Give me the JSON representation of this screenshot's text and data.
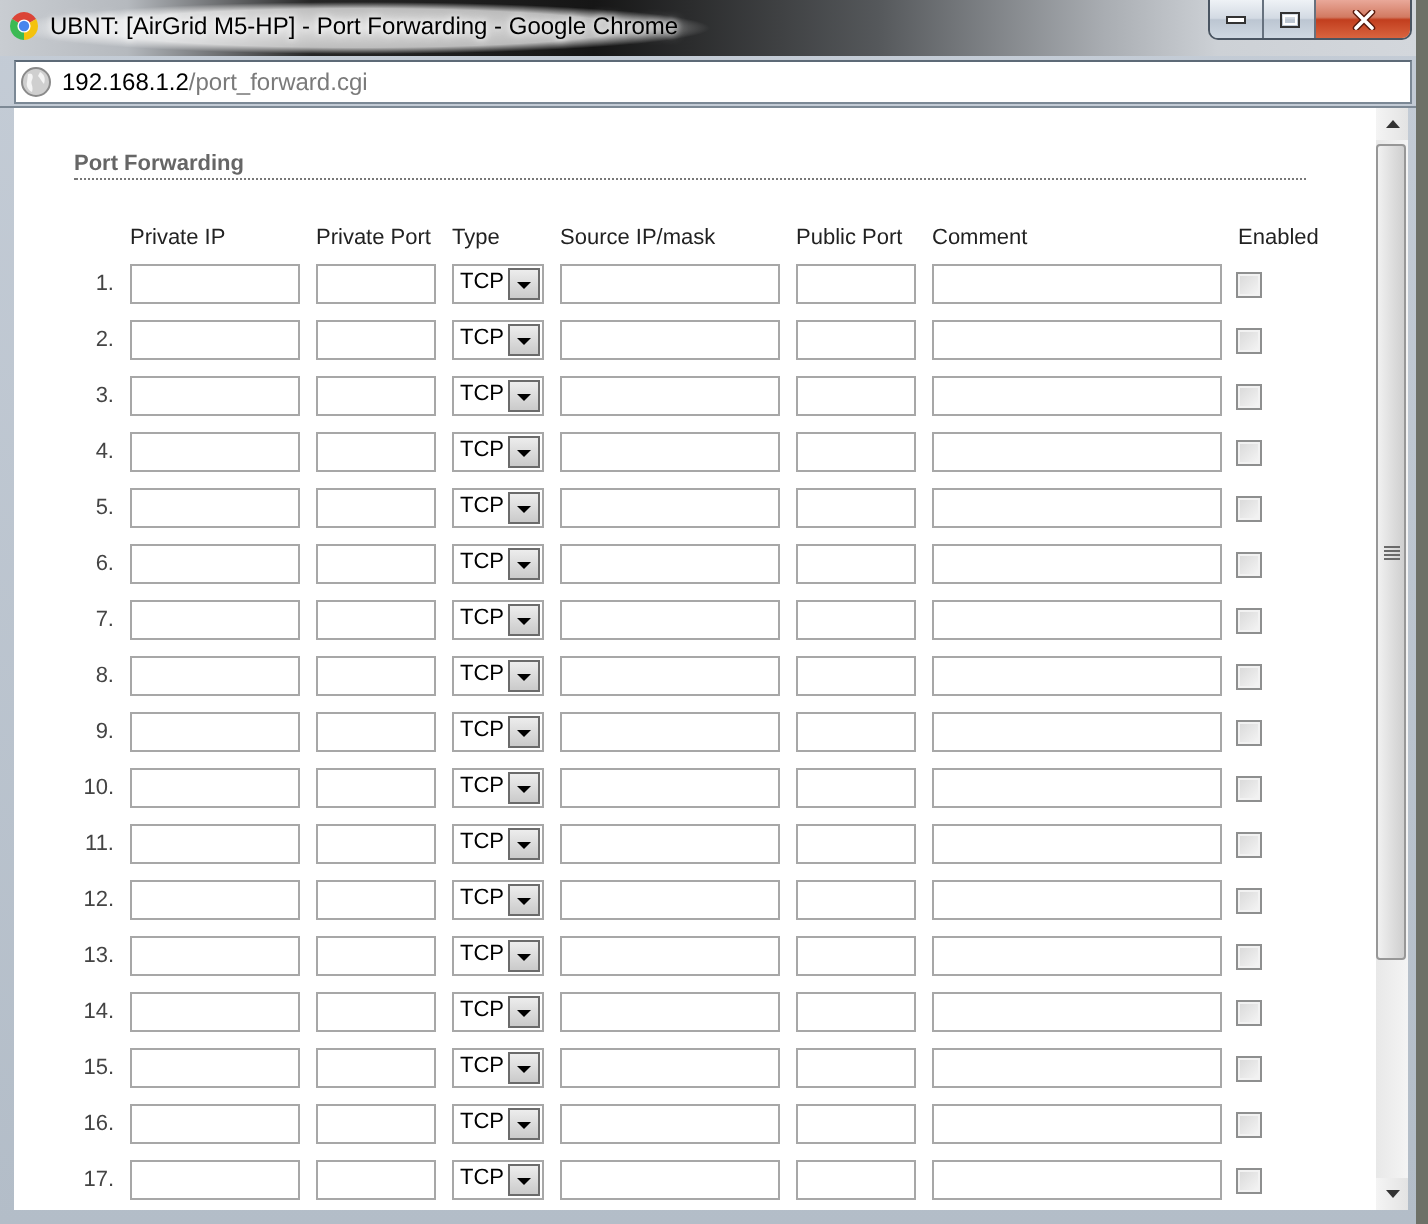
{
  "window": {
    "title": "UBNT: [AirGrid M5-HP] - Port Forwarding - Google Chrome"
  },
  "address_bar": {
    "host": "192.168.1.2",
    "path": "/port_forward.cgi"
  },
  "section_title": "Port Forwarding",
  "table": {
    "columns": [
      {
        "label": "Private IP",
        "kind": "text"
      },
      {
        "label": "Private Port",
        "kind": "text"
      },
      {
        "label": "Type",
        "kind": "select"
      },
      {
        "label": "Source IP/mask",
        "kind": "text"
      },
      {
        "label": "Public Port",
        "kind": "text"
      },
      {
        "label": "Comment",
        "kind": "text"
      },
      {
        "label": "Enabled",
        "kind": "checkbox"
      }
    ],
    "rows": [
      {
        "number": "1.",
        "type": "TCP",
        "enabled": false
      },
      {
        "number": "2.",
        "type": "TCP",
        "enabled": false
      },
      {
        "number": "3.",
        "type": "TCP",
        "enabled": false
      },
      {
        "number": "4.",
        "type": "TCP",
        "enabled": false
      },
      {
        "number": "5.",
        "type": "TCP",
        "enabled": false
      },
      {
        "number": "6.",
        "type": "TCP",
        "enabled": false
      },
      {
        "number": "7.",
        "type": "TCP",
        "enabled": false
      },
      {
        "number": "8.",
        "type": "TCP",
        "enabled": false
      },
      {
        "number": "9.",
        "type": "TCP",
        "enabled": false
      },
      {
        "number": "10.",
        "type": "TCP",
        "enabled": false
      },
      {
        "number": "11.",
        "type": "TCP",
        "enabled": false
      },
      {
        "number": "12.",
        "type": "TCP",
        "enabled": false
      },
      {
        "number": "13.",
        "type": "TCP",
        "enabled": false
      },
      {
        "number": "14.",
        "type": "TCP",
        "enabled": false
      },
      {
        "number": "15.",
        "type": "TCP",
        "enabled": false
      },
      {
        "number": "16.",
        "type": "TCP",
        "enabled": false
      },
      {
        "number": "17.",
        "type": "TCP",
        "enabled": false
      }
    ]
  }
}
